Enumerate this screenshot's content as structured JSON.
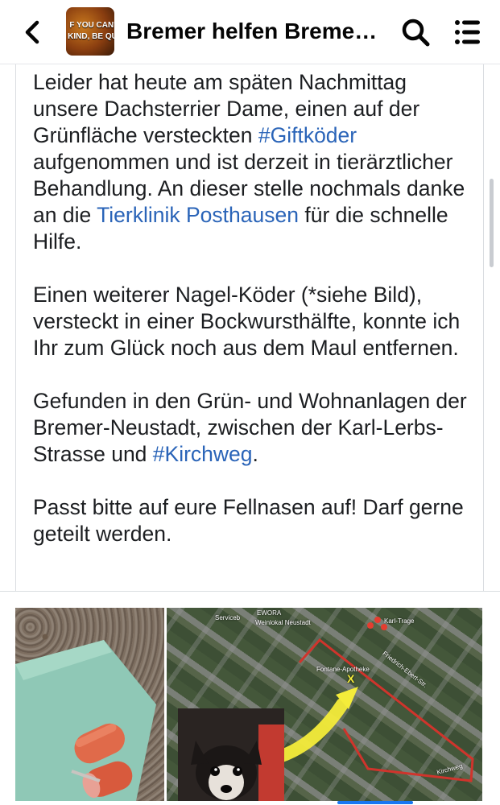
{
  "header": {
    "group_name": "Bremer helfen Breme…",
    "avatar_text_line1": "F YOU CAN'",
    "avatar_text_line2": "KIND, BE QU"
  },
  "icons": {
    "back": "chevron-left-icon",
    "search": "search-icon",
    "menu": "hamburger-menu-icon"
  },
  "post": {
    "p1": {
      "t1": "Leider hat heute am späten Nachmittag unsere Dachsterrier Dame, einen auf der Grünfläche versteckten ",
      "link1": "#Giftköder",
      "t2": " aufgenommen und ist derzeit in tierärztlicher Behandlung. An dieser stelle nochmals danke an die ",
      "link2": "Tierklinik Posthausen",
      "t3": " für die schnelle Hilfe."
    },
    "p2": "Einen weiterer Nagel-Köder (*siehe Bild), versteckt in einer Bockwursthälfte, konnte ich Ihr zum Glück noch aus dem Maul entfernen.",
    "p3": {
      "t1": "Gefunden in den Grün- und Wohnanlagen der Bremer-Neustadt, zwischen der Karl-Lerbs-Strasse und ",
      "link1": "#Kirchweg",
      "t2": "."
    },
    "p4": "Passt bitte auf eure Fellnasen auf! Darf gerne geteilt werden."
  },
  "map_labels": {
    "a": "Serviceb",
    "b": "EWORA",
    "c": "Weinlokal Neustadt",
    "d": "Karl-Trage",
    "e": "Friedrich-Ebert-Str.",
    "f": "Fontane-Apotheke",
    "g": "Kirchweg",
    "marker": "X"
  },
  "colors": {
    "link": "#2a64b8",
    "map_route": "#d0342c",
    "arrow": "#f4ec3a"
  }
}
